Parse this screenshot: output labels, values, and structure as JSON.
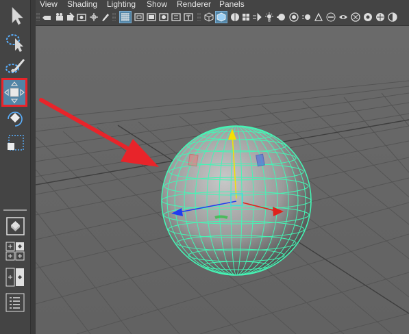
{
  "menubar": {
    "items": [
      "View",
      "Shading",
      "Lighting",
      "Show",
      "Renderer",
      "Panels"
    ]
  },
  "toolbox": {
    "tools": [
      {
        "name": "select-tool",
        "icon": "select-arrow-icon"
      },
      {
        "name": "lasso-tool",
        "icon": "lasso-icon"
      },
      {
        "name": "paint-select-tool",
        "icon": "paint-brush-icon"
      },
      {
        "name": "move-tool",
        "icon": "move-icon",
        "active": true
      },
      {
        "name": "rotate-tool",
        "icon": "rotate-icon"
      },
      {
        "name": "scale-tool",
        "icon": "scale-icon"
      }
    ],
    "layouts": [
      {
        "name": "single-perspective-layout",
        "icon": "single-view-icon"
      },
      {
        "name": "four-view-layout",
        "icon": "four-view-icon"
      },
      {
        "name": "two-view-layout",
        "icon": "two-view-icon"
      },
      {
        "name": "outliner-layout",
        "icon": "outliner-icon"
      }
    ]
  },
  "colors": {
    "panel": "#444444",
    "viewport_bg": "#686868",
    "grid": "#5a5a5a",
    "wireframe": "#45f5b5",
    "highlight": "#e8242a",
    "active_tool_bg": "#5285a6",
    "axis_x": "#e0221c",
    "axis_y": "#f4e003",
    "axis_z": "#1f3cf0"
  },
  "scene": {
    "object": "polygon sphere",
    "selected": true,
    "manipulator": "move"
  },
  "annotation": {
    "highlighted_tool": "move-tool",
    "arrow_target": "sphere"
  }
}
